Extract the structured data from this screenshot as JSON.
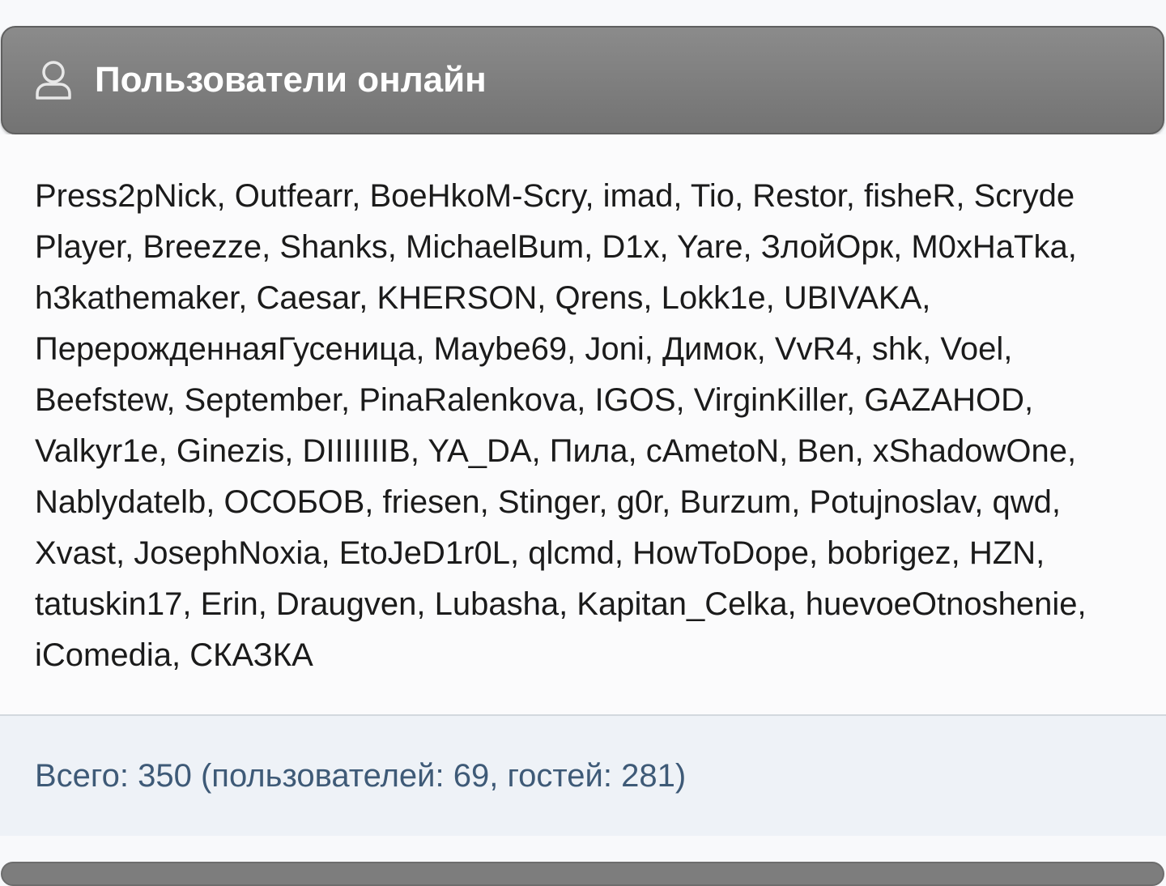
{
  "panel": {
    "icon": "user-icon",
    "title": "Пользователи онлайн"
  },
  "online_users": {
    "list_text": "Press2pNick, Outfearr, BoeHkoM-Scry, imad, Tio, Restor, fisheR, Scryde Player, Breezze, Shanks, MichaelBum, D1x, Yare, ЗлойОрк, M0xHaTka, h3kathemaker, Caesar, KHERSON, Qrens, Lokk1e, UBIVAKA, ПерерожденнаяГусеница, Maybe69, Joni, Димок, VvR4, shk, Voel, Beefstew, September, PinaRalenkova, IGOS, VirginKiller, GAZAHOD, Valkyr1e, Ginezis, DIIIIIIIB, YA_DA, Пила, cAmetoN, Ben, xShadowOne, Nablydatelb, ОСОБОВ, friesen, Stinger, g0r, Burzum, Potujnoslav, qwd, Xvast, JosephNoxia, EtoJeD1r0L, qlcmd, HowToDope, bobrigez, HZN, tatuskin17, Erin, Draugven, Lubasha, Kapitan_Celka, huevoeOtnoshenie, iComedia, СКАЗКА"
  },
  "stats": {
    "summary": "Всего: 350 (пользователей: 69, гостей: 281)"
  },
  "colors": {
    "header_bg": "#7d7d7d",
    "text": "#1b1b1b",
    "stats_text": "#3e5a77",
    "stats_bg": "#eef2f7"
  }
}
